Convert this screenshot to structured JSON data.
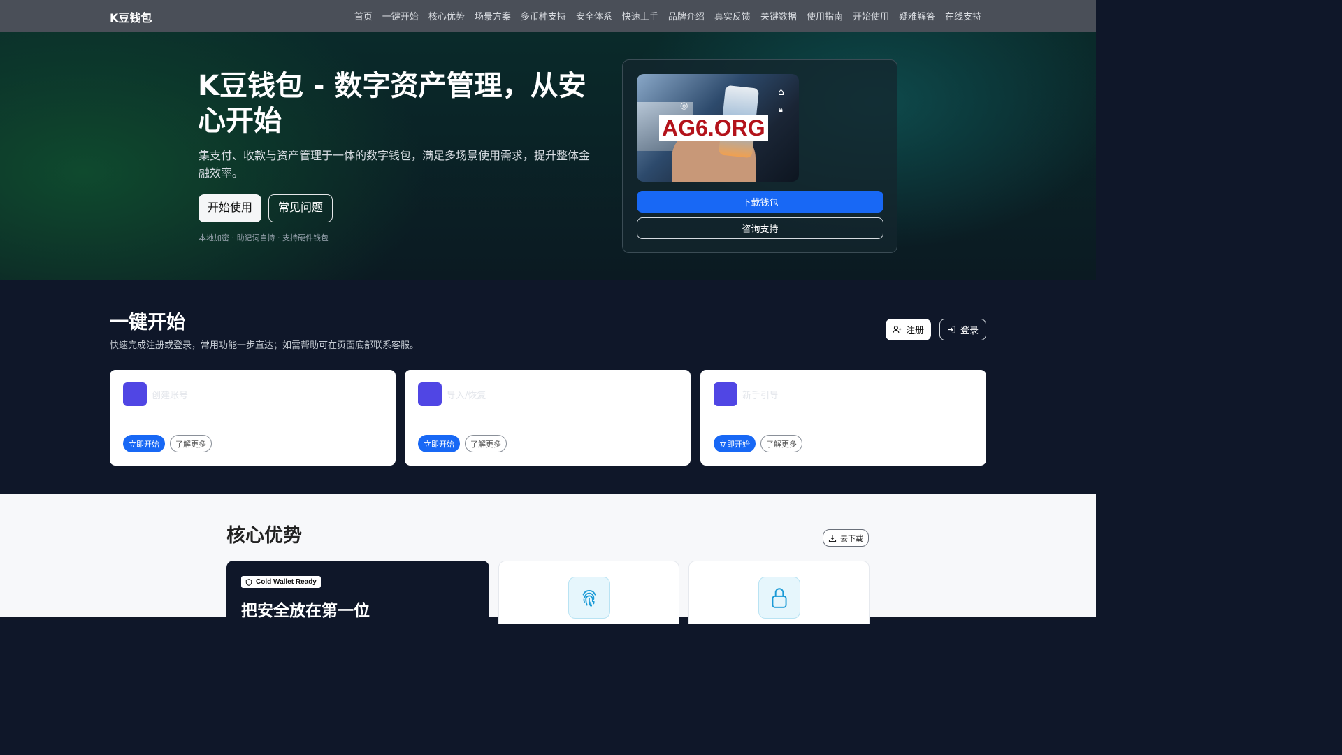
{
  "brand": "K豆钱包",
  "nav": [
    "首页",
    "一键开始",
    "核心优势",
    "场景方案",
    "多币种支持",
    "安全体系",
    "快速上手",
    "品牌介绍",
    "真实反馈",
    "关键数据",
    "使用指南",
    "开始使用",
    "疑难解答",
    "在线支持"
  ],
  "hero": {
    "title": "K豆钱包 - 数字资产管理，从安心开始",
    "subtitle": "集支付、收款与资产管理于一体的数字钱包，满足多场景使用需求，提升整体金融效率。",
    "btn_start": "开始使用",
    "btn_faq": "常见问题",
    "note": "本地加密 · 助记词自持 · 支持硬件钱包",
    "image_label": "AG6.ORG",
    "btn_download": "下载钱包",
    "btn_consult": "咨询支持"
  },
  "quick": {
    "title": "一键开始",
    "subtitle": "快速完成注册或登录，常用功能一步直达；如需帮助可在页面底部联系客服。",
    "register": "注册",
    "login": "登录",
    "cards": [
      {
        "title": "创建账号",
        "start": "立即开始",
        "more": "了解更多"
      },
      {
        "title": "导入/恢复",
        "start": "立即开始",
        "more": "了解更多"
      },
      {
        "title": "新手引导",
        "start": "立即开始",
        "more": "了解更多"
      }
    ]
  },
  "core": {
    "title": "核心优势",
    "download": "去下载",
    "badge": "Cold Wallet Ready",
    "dark_title": "把安全放在第一位",
    "icons": [
      "fingerprint-icon",
      "lock-icon"
    ]
  },
  "colors": {
    "accent": "#1868f5",
    "card_icon": "#5046e4",
    "nav_bg": "#4a4f58",
    "dark_bg": "#0f1729"
  }
}
